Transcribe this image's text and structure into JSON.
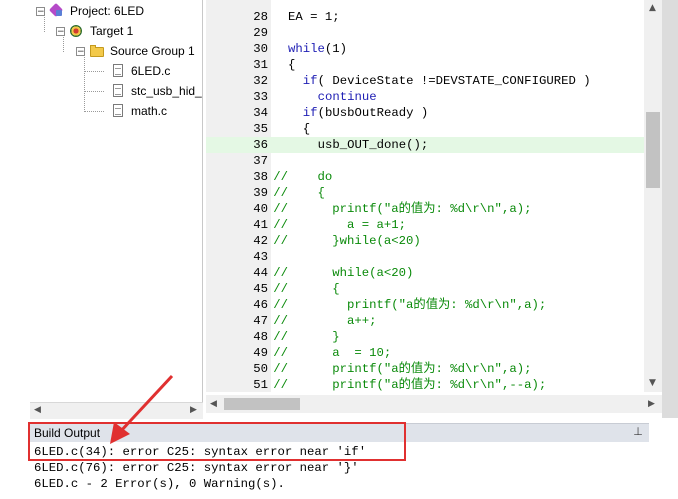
{
  "project_tree": {
    "project_label": "Project: 6LED",
    "target_label": "Target 1",
    "group_label": "Source Group 1",
    "files": [
      "6LED.c",
      "stc_usb_hid_",
      "math.c"
    ],
    "expander_symbol": "−"
  },
  "editor": {
    "lines": [
      {
        "n": "28",
        "segs": [
          {
            "t": "tx",
            "s": "EA = 1;"
          }
        ],
        "indent": 0
      },
      {
        "n": "29",
        "segs": [],
        "indent": 0
      },
      {
        "n": "30",
        "segs": [
          {
            "t": "kw",
            "s": "while"
          },
          {
            "t": "tx",
            "s": "(1)"
          }
        ],
        "indent": 0
      },
      {
        "n": "31",
        "segs": [
          {
            "t": "tx",
            "s": "{"
          }
        ],
        "indent": 0
      },
      {
        "n": "32",
        "segs": [
          {
            "t": "kw",
            "s": "if"
          },
          {
            "t": "tx",
            "s": "( DeviceState !=DEVSTATE_CONFIGURED )"
          }
        ],
        "indent": 2
      },
      {
        "n": "33",
        "segs": [
          {
            "t": "kw",
            "s": "continue"
          }
        ],
        "indent": 4
      },
      {
        "n": "34",
        "segs": [
          {
            "t": "kw",
            "s": "if"
          },
          {
            "t": "tx",
            "s": "(bUsbOutReady )"
          }
        ],
        "indent": 2
      },
      {
        "n": "35",
        "segs": [
          {
            "t": "tx",
            "s": "{"
          }
        ],
        "indent": 2
      },
      {
        "n": "36",
        "segs": [
          {
            "t": "tx",
            "s": "usb_OUT_done();"
          }
        ],
        "indent": 4,
        "highlight": true
      },
      {
        "n": "37",
        "segs": [],
        "indent": 0
      },
      {
        "n": "38",
        "segs": [
          {
            "t": "cm",
            "s": "//    do"
          }
        ],
        "indent": -2
      },
      {
        "n": "39",
        "segs": [
          {
            "t": "cm",
            "s": "//    {"
          }
        ],
        "indent": -2
      },
      {
        "n": "40",
        "segs": [
          {
            "t": "cm",
            "s": "//      printf(\"a的值为: %d\\r\\n\",a);"
          }
        ],
        "indent": -2
      },
      {
        "n": "41",
        "segs": [
          {
            "t": "cm",
            "s": "//        a = a+1;"
          }
        ],
        "indent": -2
      },
      {
        "n": "42",
        "segs": [
          {
            "t": "cm",
            "s": "//      }while(a<20)"
          }
        ],
        "indent": -2
      },
      {
        "n": "43",
        "segs": [],
        "indent": 0
      },
      {
        "n": "44",
        "segs": [
          {
            "t": "cm",
            "s": "//      while(a<20)"
          }
        ],
        "indent": -2
      },
      {
        "n": "45",
        "segs": [
          {
            "t": "cm",
            "s": "//      {"
          }
        ],
        "indent": -2
      },
      {
        "n": "46",
        "segs": [
          {
            "t": "cm",
            "s": "//        printf(\"a的值为: %d\\r\\n\",a);"
          }
        ],
        "indent": -2
      },
      {
        "n": "47",
        "segs": [
          {
            "t": "cm",
            "s": "//        a++;"
          }
        ],
        "indent": -2
      },
      {
        "n": "48",
        "segs": [
          {
            "t": "cm",
            "s": "//      }"
          }
        ],
        "indent": -2
      },
      {
        "n": "49",
        "segs": [
          {
            "t": "cm",
            "s": "//      a  = 10;"
          }
        ],
        "indent": -2
      },
      {
        "n": "50",
        "segs": [
          {
            "t": "cm",
            "s": "//      printf(\"a的值为: %d\\r\\n\",a);"
          }
        ],
        "indent": -2
      },
      {
        "n": "51",
        "segs": [
          {
            "t": "cm",
            "s": "//      printf(\"a的值为: %d\\r\\n\",--a);"
          }
        ],
        "indent": -2
      }
    ]
  },
  "build_output": {
    "title": "Build Output",
    "pin_symbol": "⊥",
    "lines": [
      "6LED.c(34): error C25: syntax error near 'if'",
      "6LED.c(76): error C25: syntax error near '}'",
      "6LED.c - 2 Error(s), 0 Warning(s)."
    ]
  },
  "colors": {
    "keyword": "#1e1eb4",
    "comment": "#0a8a0a",
    "highlight_line": "#e4f8e4",
    "annotation_red": "#e03030"
  },
  "scroll_arrows": {
    "left": "◀",
    "right": "▶",
    "up": "▲",
    "down": "▼"
  }
}
